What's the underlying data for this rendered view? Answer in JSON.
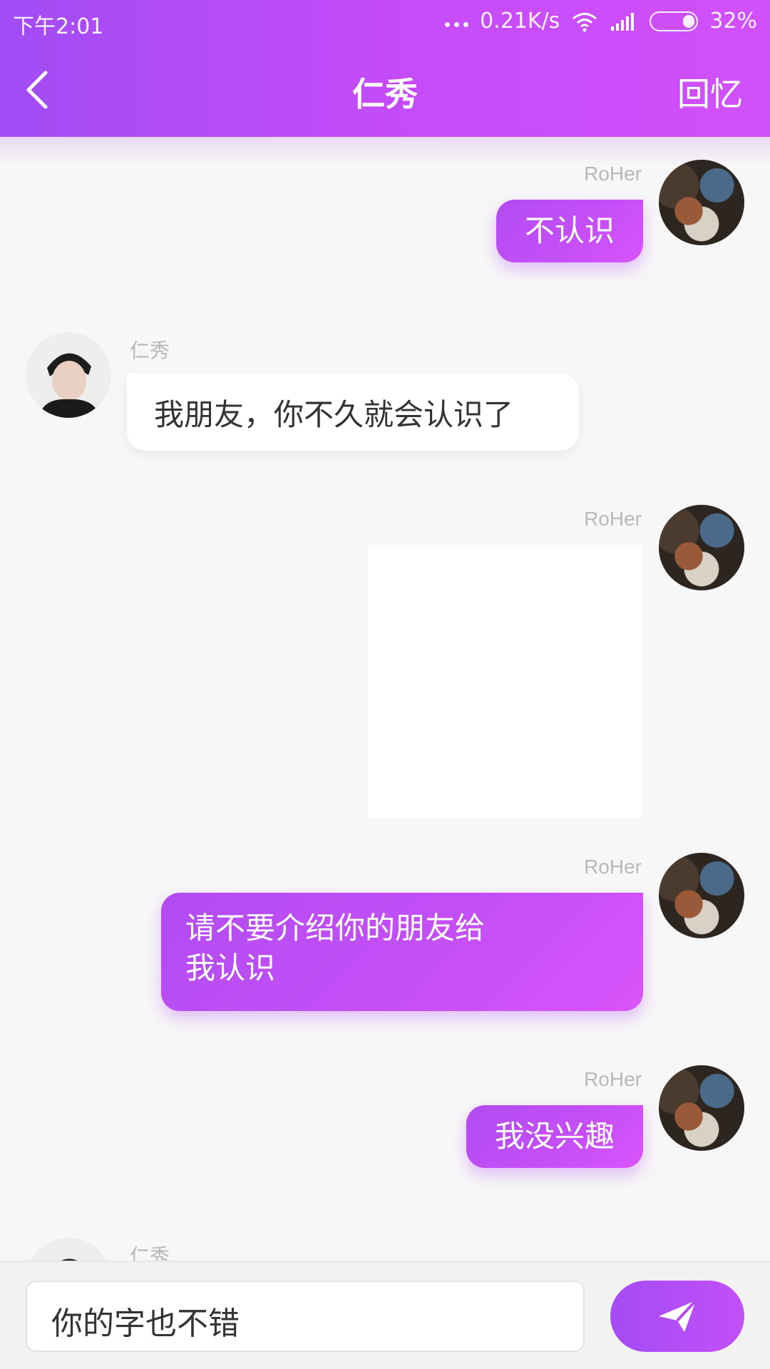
{
  "status_bar": {
    "time": "下午2:01",
    "network_speed": "0.21K/s",
    "battery": "32%"
  },
  "nav": {
    "title": "仁秀",
    "right_action": "回忆"
  },
  "messages": [
    {
      "sender": "RoHer",
      "text": "不认识"
    },
    {
      "sender": "仁秀",
      "text": "我朋友，你不久就会认识了"
    },
    {
      "sender": "RoHer"
    },
    {
      "sender": "RoHer",
      "line1": "请不要介绍你的朋友给",
      "line2": "我认识"
    },
    {
      "sender": "RoHer",
      "text": "我没兴趣"
    },
    {
      "sender": "仁秀"
    }
  ],
  "input": {
    "value": "你的字也不错"
  },
  "colors": {
    "accent": "#b44cf6",
    "accent_light": "#d150fb"
  }
}
